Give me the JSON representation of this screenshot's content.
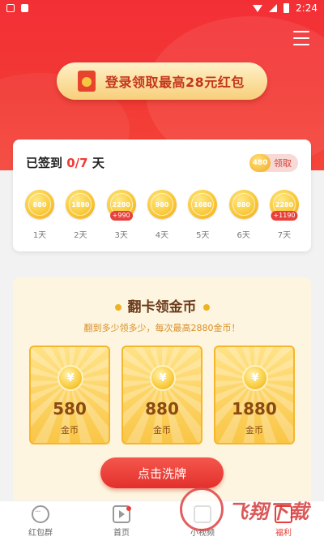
{
  "status_bar": {
    "time": "2:24"
  },
  "header": {
    "login_button_label": "登录领取最高28元红包"
  },
  "checkin": {
    "title_prefix": "已签到 ",
    "progress": "0/7",
    "title_suffix": " 天",
    "claim_coin": "480",
    "claim_label": "领取",
    "days": [
      {
        "coins": "880",
        "label": "1天",
        "bonus": ""
      },
      {
        "coins": "1880",
        "label": "2天",
        "bonus": ""
      },
      {
        "coins": "2280",
        "label": "3天",
        "bonus": "+990"
      },
      {
        "coins": "980",
        "label": "4天",
        "bonus": ""
      },
      {
        "coins": "1680",
        "label": "5天",
        "bonus": ""
      },
      {
        "coins": "880",
        "label": "6天",
        "bonus": ""
      },
      {
        "coins": "2280",
        "label": "7天",
        "bonus": "+1190"
      }
    ]
  },
  "flip": {
    "title": "翻卡领金币",
    "subtitle": "翻到多少领多少，每次最高2880金币！",
    "cards": [
      {
        "amount": "580",
        "unit": "金币",
        "coin_symbol": "¥"
      },
      {
        "amount": "880",
        "unit": "金币",
        "coin_symbol": "¥"
      },
      {
        "amount": "1880",
        "unit": "金币",
        "coin_symbol": "¥"
      }
    ],
    "shuffle_label": "点击洗牌"
  },
  "bottom_nav": [
    {
      "label": "红包群",
      "icon": "chat-icon",
      "active": false
    },
    {
      "label": "首页",
      "icon": "home-play-icon",
      "active": false
    },
    {
      "label": "小视频",
      "icon": "video-icon",
      "active": false
    },
    {
      "label": "福利",
      "icon": "gift-icon",
      "active": true
    }
  ],
  "watermark": {
    "text": "飞翔下载"
  },
  "colors": {
    "brand_red": "#f23a34",
    "gold": "#f9c93a",
    "cream": "#fdf5df"
  }
}
